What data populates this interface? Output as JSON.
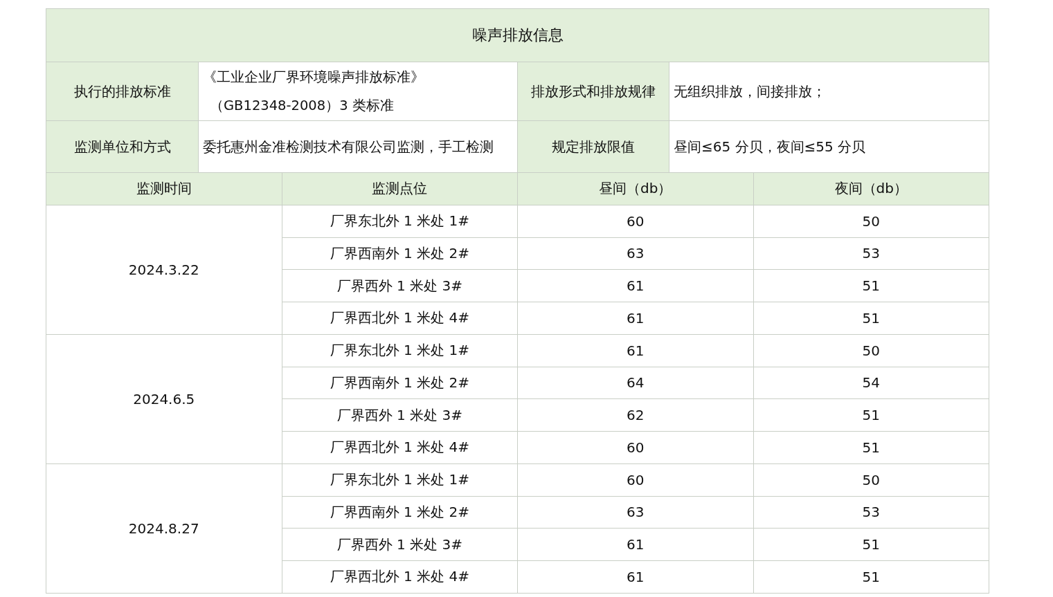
{
  "title": "噪声排放信息",
  "info": [
    {
      "label": "执行的排放标准",
      "lines": [
        "《工业企业厂界环境噪声排放标准》",
        "（GB12348-2008）3 类标准"
      ],
      "label2": "排放形式和排放规律",
      "value2": "无组织排放，间接排放；"
    },
    {
      "label": "监测单位和方式",
      "lines": [
        "委托惠州金准检测技术有限公司监测，手工检测"
      ],
      "label2": "规定排放限值",
      "value2": "昼间≤65 分贝，夜间≤55 分贝"
    }
  ],
  "columns": [
    "监测时间",
    "监测点位",
    "昼间（db）",
    "夜间（db）"
  ],
  "groups": [
    {
      "date": "2024.3.22",
      "rows": [
        {
          "point": "厂界东北外 1 米处 1#",
          "day": "60",
          "night": "50"
        },
        {
          "point": "厂界西南外 1 米处 2#",
          "day": "63",
          "night": "53"
        },
        {
          "point": "厂界西外 1 米处 3#",
          "day": "61",
          "night": "51"
        },
        {
          "point": "厂界西北外 1 米处 4#",
          "day": "61",
          "night": "51"
        }
      ]
    },
    {
      "date": "2024.6.5",
      "rows": [
        {
          "point": "厂界东北外 1 米处 1#",
          "day": "61",
          "night": "50"
        },
        {
          "point": "厂界西南外 1 米处 2#",
          "day": "64",
          "night": "54"
        },
        {
          "point": "厂界西外 1 米处 3#",
          "day": "62",
          "night": "51"
        },
        {
          "point": "厂界西北外 1 米处 4#",
          "day": "60",
          "night": "51"
        }
      ]
    },
    {
      "date": "2024.8.27",
      "rows": [
        {
          "point": "厂界东北外 1 米处 1#",
          "day": "60",
          "night": "50"
        },
        {
          "point": "厂界西南外 1 米处 2#",
          "day": "63",
          "night": "53"
        },
        {
          "point": "厂界西外 1 米处 3#",
          "day": "61",
          "night": "51"
        },
        {
          "point": "厂界西北外 1 米处 4#",
          "day": "61",
          "night": "51"
        }
      ]
    }
  ]
}
